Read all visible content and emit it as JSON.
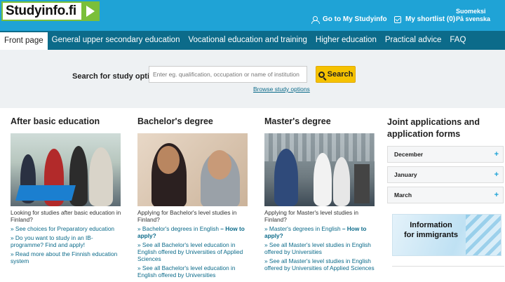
{
  "header": {
    "logo_text": "Studyinfo.fi",
    "my_studyinfo": "Go to My Studyinfo",
    "my_shortlist": "My shortlist (0)",
    "lang_fi": "Suomeksi",
    "lang_sv": "På svenska",
    "icons": {
      "my_studyinfo": "person-icon",
      "shortlist": "check-icon"
    }
  },
  "nav": {
    "items": [
      "Front page",
      "General upper secondary education",
      "Vocational education and training",
      "Higher education",
      "Practical advice",
      "FAQ"
    ]
  },
  "search": {
    "label": "Search for study options",
    "placeholder": "Enter eg. qualification, occupation or name of institution",
    "button": "Search",
    "browse": "Browse study options"
  },
  "columns": [
    {
      "title": "After basic education",
      "intro": "Looking for studies after basic education in Finland?",
      "links": [
        "» See choices for Preparatory education",
        "» Do you want to study in an IB-programme? Find and apply!",
        "» Read more about the Finnish education system"
      ]
    },
    {
      "title": "Bachelor's degree",
      "intro": "Applying for Bachelor's level studies in Finland?",
      "links": [
        "» Bachelor's degrees in English",
        "– How to apply?",
        "» See all Bachelor's level education in English offered by Universities of Applied Sciences",
        "» See all Bachelor's level education in English offered by Universities"
      ]
    },
    {
      "title": "Master's degree",
      "intro": "Applying for Master's level studies in Finland?",
      "links": [
        "» Master's degrees in English",
        "– How to apply?",
        "» See all Master's level studies in English offered by Universities",
        "» See all Master's level studies in English offered by Universities of Applied Sciences"
      ]
    }
  ],
  "applications": {
    "title": "Joint applications and application forms",
    "months": [
      "December",
      "January",
      "March"
    ],
    "immigrants_line1": "Information",
    "immigrants_line2": "for immigrants"
  },
  "colors": {
    "header": "#1fa3d6",
    "nav": "#0c6b8a",
    "accent": "#7bbf3a",
    "search_button": "#f5c200"
  }
}
